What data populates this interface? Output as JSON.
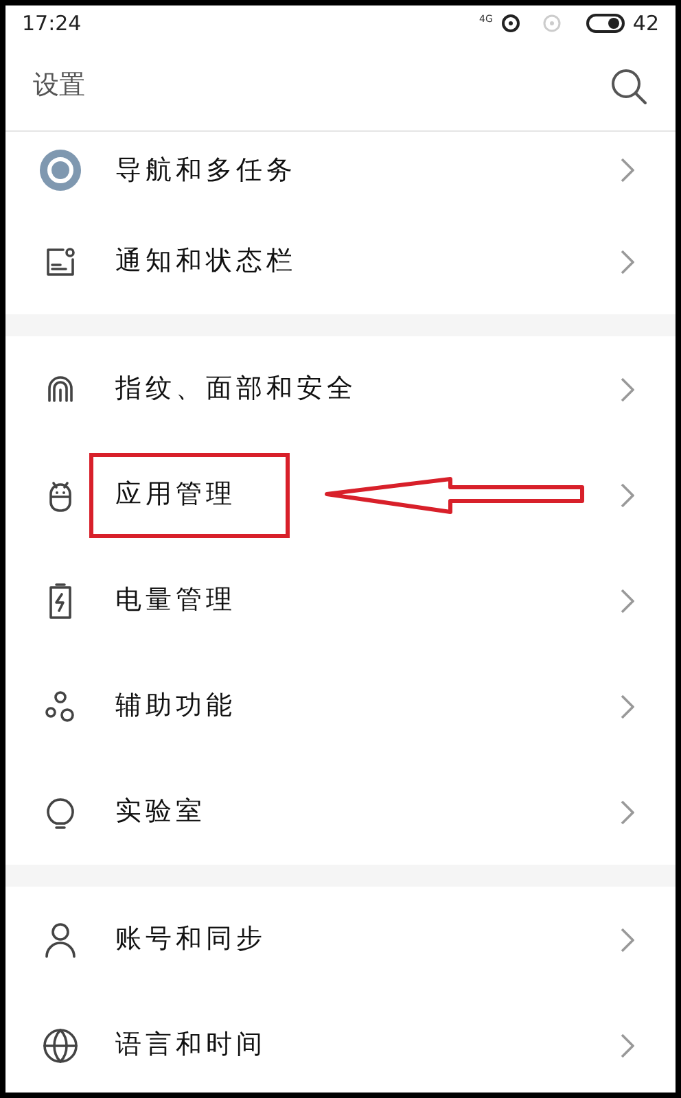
{
  "status_bar": {
    "time": "17:24",
    "network": "4G",
    "battery": "42"
  },
  "header": {
    "title": "设置"
  },
  "groups": [
    [
      {
        "label": "导航和多任务",
        "highlighted": false
      },
      {
        "label": "通知和状态栏",
        "highlighted": false
      }
    ],
    [
      {
        "label": "指纹、面部和安全",
        "highlighted": false
      },
      {
        "label": "应用管理",
        "highlighted": true
      },
      {
        "label": "电量管理",
        "highlighted": false
      },
      {
        "label": "辅助功能",
        "highlighted": false
      },
      {
        "label": "实验室",
        "highlighted": false
      }
    ],
    [
      {
        "label": "账号和同步",
        "highlighted": false
      },
      {
        "label": "语言和时间",
        "highlighted": false
      }
    ]
  ]
}
